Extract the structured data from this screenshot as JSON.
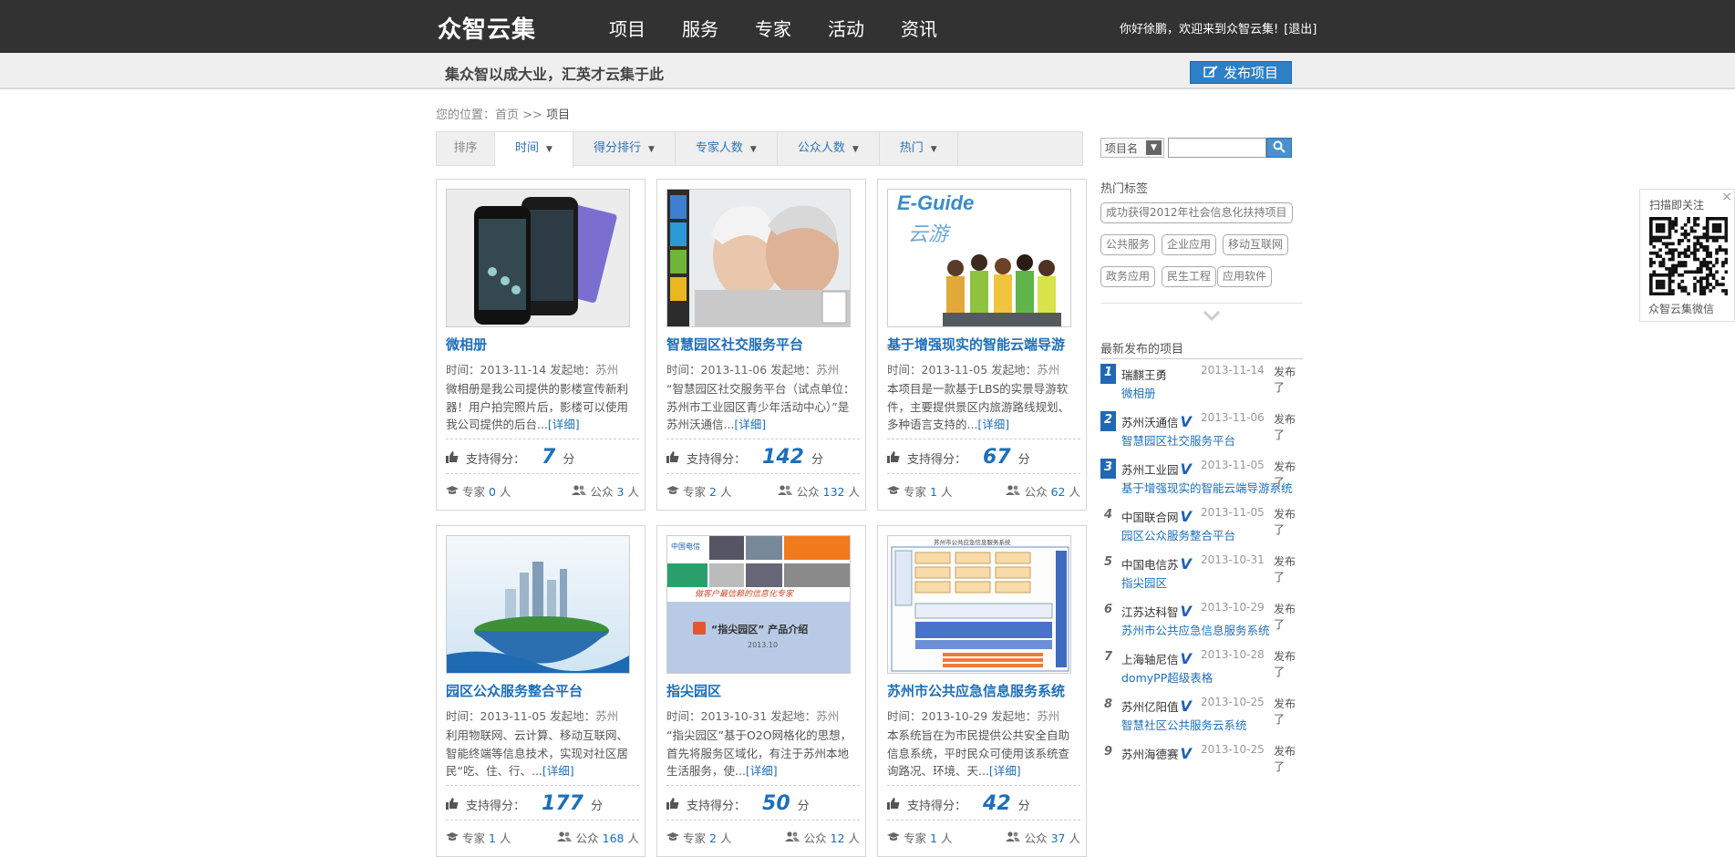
{
  "header": {
    "logo": "众智云集",
    "nav": [
      "项目",
      "服务",
      "专家",
      "活动",
      "资讯"
    ],
    "welcome": "你好徐鹏，欢迎来到众智云集!",
    "logout": "[退出]"
  },
  "subheader": {
    "slogan": "集众智以成大业，汇英才云集于此",
    "publish_label": "发布项目"
  },
  "breadcrumb": {
    "prefix": "您的位置：",
    "home": "首页",
    "separator": " >> ",
    "current": "项目"
  },
  "sortbar": {
    "label": "排序",
    "tabs": [
      "时间",
      "得分排行",
      "专家人数",
      "公众人数",
      "热门"
    ],
    "active": "时间"
  },
  "card_labels": {
    "time": "时间：",
    "origin": "发起地：",
    "more": "[详细]",
    "score": "支持得分：",
    "score_unit": "分",
    "expert": "专家",
    "public": "公众",
    "person_unit": "人"
  },
  "projects": [
    {
      "title": "微相册",
      "date": "2013-11-14",
      "location": "苏州",
      "desc": "微相册是我公司提供的影楼宣传新利器！用户拍完照片后，影楼可以使用我公司提供的后台...",
      "score": "7",
      "experts": "0",
      "public": "3"
    },
    {
      "title": "智慧园区社交服务平台",
      "date": "2013-11-06",
      "location": "苏州",
      "desc": "“智慧园区社交服务平台（试点单位：苏州市工业园区青少年活动中心）”是苏州沃通信...",
      "score": "142",
      "experts": "2",
      "public": "132"
    },
    {
      "title": "基于增强现实的智能云端导游",
      "date": "2013-11-05",
      "location": "苏州",
      "desc": "本项目是一款基于LBS的实景导游软件，主要提供景区内旅游路线规划、多种语言支持的...",
      "score": "67",
      "experts": "1",
      "public": "62"
    },
    {
      "title": "园区公众服务整合平台",
      "date": "2013-11-05",
      "location": "苏州",
      "desc": "利用物联网、云计算、移动互联网、智能终端等信息技术，实现对社区居民“吃、住、行、...",
      "score": "177",
      "experts": "1",
      "public": "168"
    },
    {
      "title": "指尖园区",
      "date": "2013-10-31",
      "location": "苏州",
      "desc": "“指尖园区”基于O2O网格化的思想，首先将服务区域化，有注于苏州本地生活服务，使...",
      "score": "50",
      "experts": "2",
      "public": "12"
    },
    {
      "title": "苏州市公共应急信息服务系统",
      "date": "2013-10-29",
      "location": "苏州",
      "desc": "本系统旨在为市民提供公共安全自助信息系统，平时民众可使用该系统查询路况、环境、天...",
      "score": "42",
      "experts": "1",
      "public": "37"
    }
  ],
  "thumb_texts": {
    "eguide": "E-Guide",
    "eguide_sub": "云游",
    "zhijian_title": "“指尖园区” 产品介绍",
    "zhijian_date": "2013.10",
    "zhijian_slogan": "做客户最信赖的信息化专家",
    "emergency_title": "苏州市公共应急信息服务系统"
  },
  "sidebar": {
    "search_select": "项目名",
    "search_placeholder": "",
    "hot_tags_title": "热门标签",
    "tags": [
      "成功获得2012年社会信息化扶持项目",
      "公共服务",
      "企业应用",
      "移动互联网",
      "政务应用",
      "民生工程",
      "应用软件"
    ],
    "recent_title": "最新发布的项目",
    "published_label": "发布了",
    "recent": [
      {
        "rank": "1",
        "author": "瑞麒王勇",
        "verified": false,
        "date": "2013-11-14",
        "project": "微相册"
      },
      {
        "rank": "2",
        "author": "苏州沃通信",
        "verified": true,
        "date": "2013-11-06",
        "project": "智慧园区社交服务平台"
      },
      {
        "rank": "3",
        "author": "苏州工业园",
        "verified": true,
        "date": "2013-11-05",
        "project": "基于增强现实的智能云端导游系统"
      },
      {
        "rank": "4",
        "author": "中国联合网",
        "verified": true,
        "date": "2013-11-05",
        "project": "园区公众服务整合平台"
      },
      {
        "rank": "5",
        "author": "中国电信苏",
        "verified": true,
        "date": "2013-10-31",
        "project": "指尖园区"
      },
      {
        "rank": "6",
        "author": "江苏达科智",
        "verified": true,
        "date": "2013-10-29",
        "project": "苏州市公共应急信息服务系统"
      },
      {
        "rank": "7",
        "author": "上海轴尼信",
        "verified": true,
        "date": "2013-10-28",
        "project": "domyPP超级表格"
      },
      {
        "rank": "8",
        "author": "苏州亿阳值",
        "verified": true,
        "date": "2013-10-25",
        "project": "智慧社区公共服务云系统"
      },
      {
        "rank": "9",
        "author": "苏州海德赛",
        "verified": true,
        "date": "2013-10-25",
        "project": ""
      }
    ]
  },
  "qr": {
    "title": "扫描即关注",
    "close": "×",
    "caption": "众智云集微信"
  }
}
